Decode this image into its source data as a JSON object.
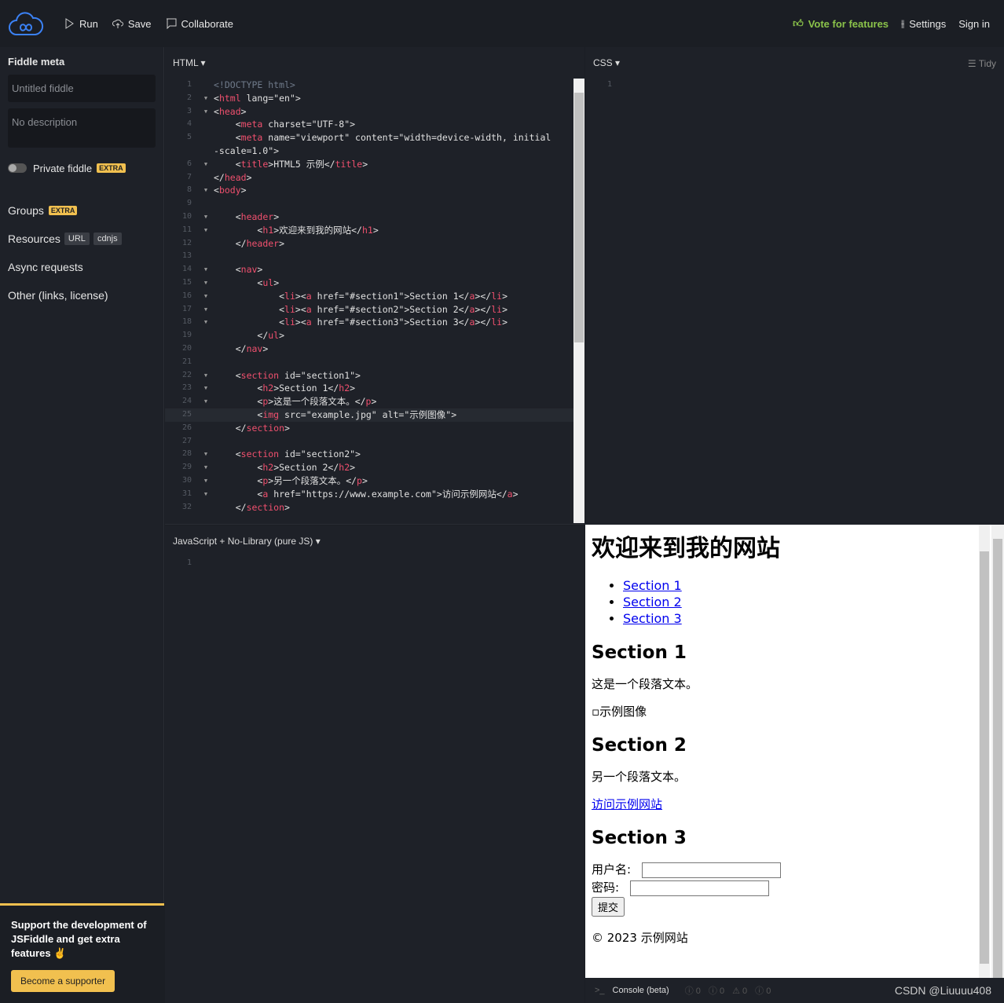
{
  "topbar": {
    "run": "Run",
    "save": "Save",
    "collaborate": "Collaborate",
    "vote": "Vote for features",
    "settings": "Settings",
    "signin": "Sign in",
    "accent": "#3b82f6",
    "vote_color": "#8bc34a"
  },
  "sidebar": {
    "title": "Fiddle meta",
    "name_placeholder": "Untitled fiddle",
    "desc_placeholder": "No description",
    "private": "Private fiddle",
    "extra": "EXTRA",
    "groups": "Groups",
    "resources": "Resources",
    "url": "URL",
    "cdnjs": "cdnjs",
    "async": "Async requests",
    "other": "Other (links, license)",
    "support_text": "Support the development of JSFiddle and get extra features ✌",
    "support_button": "Become a supporter"
  },
  "html_pane": {
    "label": "HTML ▾",
    "cursor_line": 25,
    "lines": [
      "<!DOCTYPE html>",
      "<html lang=\"en\">",
      "<head>",
      "    <meta charset=\"UTF-8\">",
      "    <meta name=\"viewport\" content=\"width=device-width, initial-scale=1.0\">",
      "    <title>HTML5 示例</title>",
      "</head>",
      "<body>",
      "",
      "    <header>",
      "        <h1>欢迎来到我的网站</h1>",
      "    </header>",
      "",
      "    <nav>",
      "        <ul>",
      "            <li><a href=\"#section1\">Section 1</a></li>",
      "            <li><a href=\"#section2\">Section 2</a></li>",
      "            <li><a href=\"#section3\">Section 3</a></li>",
      "        </ul>",
      "    </nav>",
      "",
      "    <section id=\"section1\">",
      "        <h2>Section 1</h2>",
      "        <p>这是一个段落文本。</p>",
      "        <img src=\"example.jpg\" alt=\"示例图像\">",
      "    </section>",
      "",
      "    <section id=\"section2\">",
      "        <h2>Section 2</h2>",
      "        <p>另一个段落文本。</p>",
      "        <a href=\"https://www.example.com\">访问示例网站</a>",
      "    </section>"
    ],
    "folds": [
      2,
      3,
      6,
      8,
      10,
      11,
      14,
      15,
      16,
      17,
      18,
      22,
      23,
      24,
      28,
      29,
      30,
      31
    ]
  },
  "css_pane": {
    "label": "CSS ▾",
    "tidy": "Tidy"
  },
  "js_pane": {
    "label": "JavaScript + No-Library (pure JS) ▾"
  },
  "result": {
    "h1": "欢迎来到我的网站",
    "nav": [
      "Section 1",
      "Section 2",
      "Section 3"
    ],
    "s1_title": "Section 1",
    "s1_p": "这是一个段落文本。",
    "img_alt": "示例图像",
    "s2_title": "Section 2",
    "s2_p": "另一个段落文本。",
    "s2_link": "访问示例网站",
    "s3_title": "Section 3",
    "username": "用户名:",
    "password": "密码:",
    "submit": "提交",
    "footer": "© 2023 示例网站"
  },
  "console": {
    "label": "Console (beta)",
    "counts": [
      "0",
      "0",
      "0",
      "0"
    ],
    "watermark": "CSDN @Liuuuu408"
  }
}
